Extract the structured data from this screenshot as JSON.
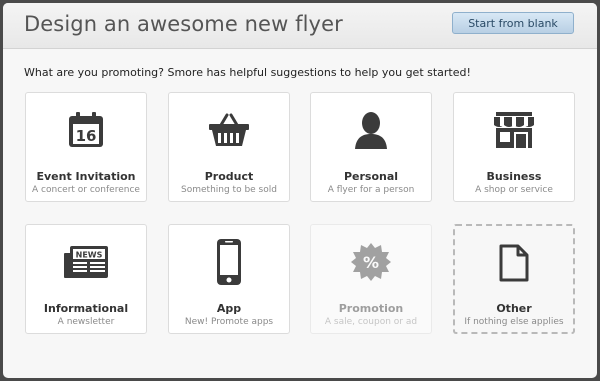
{
  "dialog": {
    "title": "Design an awesome new flyer",
    "start_blank_label": "Start from blank",
    "prompt": "What are you promoting? Smore has helpful suggestions to help you get started!"
  },
  "cards": [
    {
      "label": "Event Invitation",
      "sub": "A concert or conference",
      "icon": "calendar-icon",
      "date": "16"
    },
    {
      "label": "Product",
      "sub": "Something to be sold",
      "icon": "basket-icon"
    },
    {
      "label": "Personal",
      "sub": "A flyer for a person",
      "icon": "person-icon"
    },
    {
      "label": "Business",
      "sub": "A shop or service",
      "icon": "storefront-icon"
    },
    {
      "label": "Informational",
      "sub": "A newsletter",
      "icon": "newspaper-icon",
      "badge": "NEWS"
    },
    {
      "label": "App",
      "sub": "New! Promote apps",
      "icon": "phone-icon"
    },
    {
      "label": "Promotion",
      "sub": "A sale, coupon or ad",
      "icon": "percent-badge-icon",
      "symbol": "%"
    },
    {
      "label": "Other",
      "sub": "If nothing else applies",
      "icon": "document-icon"
    }
  ]
}
